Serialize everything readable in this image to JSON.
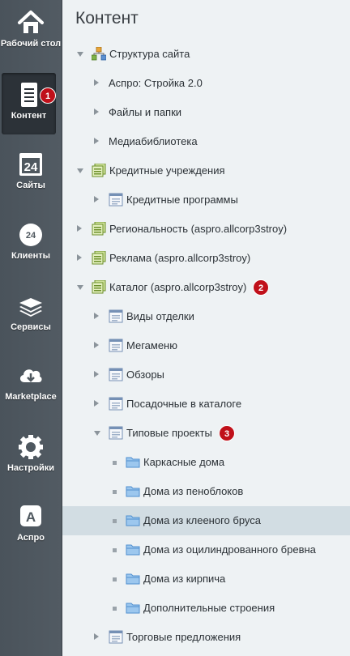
{
  "sidebar": {
    "items": [
      {
        "label": "Рабочий стол",
        "icon": "home-icon"
      },
      {
        "label": "Контент",
        "icon": "document-icon",
        "badge": "1"
      },
      {
        "label": "Сайты",
        "icon": "calendar-icon",
        "number": "24"
      },
      {
        "label": "Клиенты",
        "icon": "cloud-24-icon",
        "number": "24"
      },
      {
        "label": "Сервисы",
        "icon": "layers-icon"
      },
      {
        "label": "Marketplace",
        "icon": "cloud-download-icon"
      },
      {
        "label": "Настройки",
        "icon": "gear-icon"
      },
      {
        "label": "Аспро",
        "icon": "aspro-logo-icon",
        "letter": "A"
      }
    ]
  },
  "main": {
    "title": "Контент",
    "tree": [
      {
        "label": "Структура сайта",
        "level": 0,
        "expander": "down",
        "icon": "site-structure"
      },
      {
        "label": "Аспро: Стройка 2.0",
        "level": 1,
        "expander": "right",
        "icon": "none"
      },
      {
        "label": "Файлы и папки",
        "level": 1,
        "expander": "right",
        "icon": "none"
      },
      {
        "label": "Медиабиблиотека",
        "level": 1,
        "expander": "right",
        "icon": "none"
      },
      {
        "label": "Кредитные учреждения",
        "level": 0,
        "expander": "down",
        "icon": "iblock-type"
      },
      {
        "label": "Кредитные программы",
        "level": 1,
        "expander": "right",
        "icon": "iblock"
      },
      {
        "label": "Региональность (aspro.allcorp3stroy)",
        "level": 0,
        "expander": "right",
        "icon": "iblock-type"
      },
      {
        "label": "Реклама (aspro.allcorp3stroy)",
        "level": 0,
        "expander": "right",
        "icon": "iblock-type"
      },
      {
        "label": "Каталог (aspro.allcorp3stroy)",
        "level": 0,
        "expander": "down",
        "icon": "iblock-type",
        "badge": "2"
      },
      {
        "label": "Виды отделки",
        "level": 1,
        "expander": "right",
        "icon": "iblock"
      },
      {
        "label": "Мегаменю",
        "level": 1,
        "expander": "right",
        "icon": "iblock"
      },
      {
        "label": "Обзоры",
        "level": 1,
        "expander": "right",
        "icon": "iblock"
      },
      {
        "label": "Посадочные в каталоге",
        "level": 1,
        "expander": "right",
        "icon": "iblock"
      },
      {
        "label": "Типовые проекты",
        "level": 1,
        "expander": "down",
        "icon": "iblock",
        "badge": "3"
      },
      {
        "label": "Каркасные дома",
        "level": 2,
        "expander": "dot",
        "icon": "folder"
      },
      {
        "label": "Дома из пеноблоков",
        "level": 2,
        "expander": "dot",
        "icon": "folder"
      },
      {
        "label": "Дома из клееного бруса",
        "level": 2,
        "expander": "dot",
        "icon": "folder",
        "selected": true
      },
      {
        "label": "Дома из оцилиндрованного бревна",
        "level": 2,
        "expander": "dot",
        "icon": "folder"
      },
      {
        "label": "Дома из кирпича",
        "level": 2,
        "expander": "dot",
        "icon": "folder"
      },
      {
        "label": "Дополнительные строения",
        "level": 2,
        "expander": "dot",
        "icon": "folder"
      },
      {
        "label": "Торговые предложения",
        "level": 1,
        "expander": "right",
        "icon": "iblock"
      }
    ]
  },
  "colors": {
    "sidebar_bg": "#4f585f",
    "active_bg": "#2c3238",
    "badge": "#c0101a",
    "selected_row": "#d2dde3",
    "content_bg": "#eef2f4"
  }
}
